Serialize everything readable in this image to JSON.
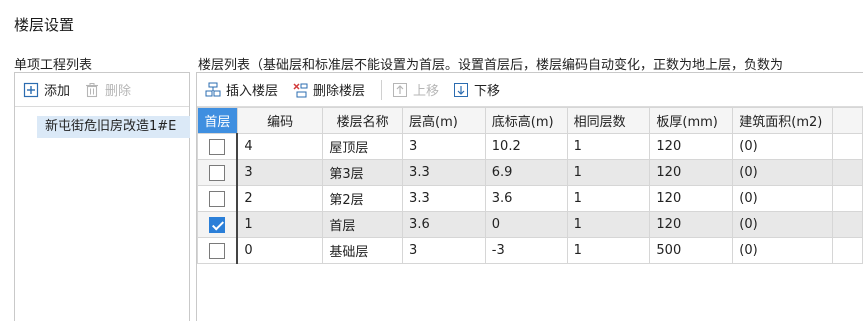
{
  "window": {
    "title": "楼层设置"
  },
  "left": {
    "header": "单项工程列表",
    "toolbar": {
      "add_label": "添加",
      "delete_label": "删除"
    },
    "tree": [
      {
        "label": "新屯街危旧房改造1#E"
      }
    ]
  },
  "right": {
    "header": "楼层列表（基础层和标准层不能设置为首层。设置首层后，楼层编码自动变化，正数为地上层，负数为",
    "toolbar": {
      "insert_label": "插入楼层",
      "delete_label": "删除楼层",
      "up_label": "上移",
      "down_label": "下移"
    },
    "columns": [
      "首层",
      "编码",
      "楼层名称",
      "层高(m)",
      "底标高(m)",
      "相同层数",
      "板厚(mm)",
      "建筑面积(m2)"
    ],
    "rows": [
      {
        "first_floor": false,
        "code": "4",
        "name": "屋顶层",
        "height": "3",
        "bottom_elev": "10.2",
        "same_count": "1",
        "slab": "120",
        "area": "(0)"
      },
      {
        "first_floor": false,
        "code": "3",
        "name": "第3层",
        "height": "3.3",
        "bottom_elev": "6.9",
        "same_count": "1",
        "slab": "120",
        "area": "(0)"
      },
      {
        "first_floor": false,
        "code": "2",
        "name": "第2层",
        "height": "3.3",
        "bottom_elev": "3.6",
        "same_count": "1",
        "slab": "120",
        "area": "(0)"
      },
      {
        "first_floor": true,
        "code": "1",
        "name": "首层",
        "height": "3.6",
        "bottom_elev": "0",
        "same_count": "1",
        "slab": "120",
        "area": "(0)"
      },
      {
        "first_floor": false,
        "code": "0",
        "name": "基础层",
        "height": "3",
        "bottom_elev": "-3",
        "same_count": "1",
        "slab": "500",
        "area": "(0)"
      }
    ]
  },
  "colors": {
    "accent": "#2b7fd8",
    "header_active": "#3f8fe0",
    "selection": "#dbe9f7",
    "alt_row": "#e8e8e8"
  },
  "icons": [
    "add-icon",
    "trash-icon",
    "insert-floor-icon",
    "delete-floor-icon",
    "move-up-icon",
    "move-down-icon"
  ]
}
